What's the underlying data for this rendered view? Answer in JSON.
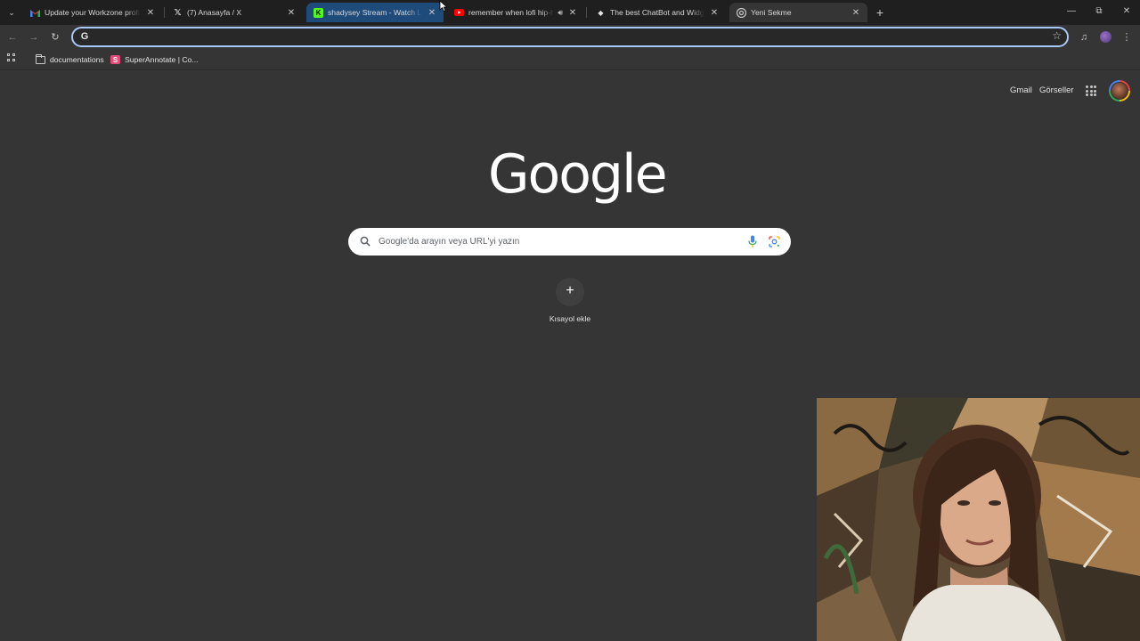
{
  "tabs": [
    {
      "title": "Update your Workzone profile",
      "favicon": "gmail-icon"
    },
    {
      "title": "(7) Anasayfa / X",
      "favicon": "x-icon"
    },
    {
      "title": "shadysey Stream - Watch Live",
      "favicon": "kick-icon"
    },
    {
      "title": "remember when lofi hip-hop",
      "favicon": "youtube-icon"
    },
    {
      "title": "The best ChatBot and Widgets",
      "favicon": "chatbot-icon"
    },
    {
      "title": "Yeni Sekme",
      "favicon": "chrome-icon"
    }
  ],
  "omnibox": {
    "value": "",
    "placeholder": ""
  },
  "bookmarks": [
    {
      "label": "documentations",
      "icon": "folder-icon"
    },
    {
      "label": "SuperAnnotate | Co...",
      "icon": "superannotate-icon"
    }
  ],
  "ntp": {
    "gmail_label": "Gmail",
    "images_label": "Görseller",
    "logo_text": "Google",
    "search_placeholder": "Google'da arayın veya URL'yi yazın",
    "shortcut_label": "Kısayol ekle"
  },
  "colors": {
    "tabstrip_bg": "#1f1f1f",
    "page_bg": "#353535",
    "hover_tab": "#1f4b7a",
    "omnibox_focus": "#a8c7fa",
    "kick_green": "#53fc18",
    "youtube_red": "#ff0000"
  }
}
